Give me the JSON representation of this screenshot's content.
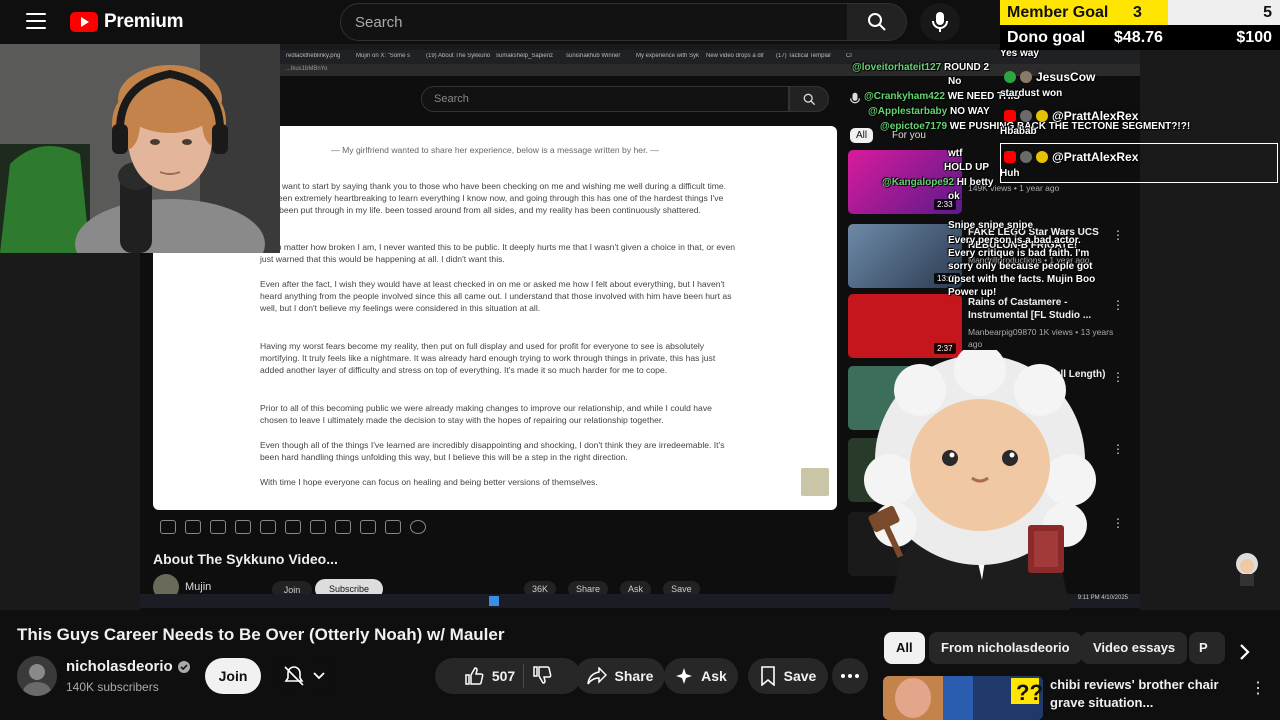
{
  "header": {
    "logo_text": "Premium",
    "search_placeholder": "Search"
  },
  "goals": {
    "member_label": "Member Goal",
    "member_current": "3",
    "member_target": "5",
    "dono_label": "Dono goal",
    "dono_current": "$48.76",
    "dono_target": "$100"
  },
  "stream": {
    "browser_tabs": [
      "redlacktheblinky.png",
      "Mujin on X: \"Some s",
      "(19) About The Sykkuno",
      "sumakshelp_Sapienz",
      "sunishakhub Winner",
      "My experience with Syk",
      "New video drops a dif",
      "(17) Tactical Templar",
      "Cl"
    ],
    "url": "...lkus1bMBnYo",
    "inner_search_placeholder": "Search",
    "doc": {
      "header": "— My girlfriend wanted to share her experience, below is a message written by her. —",
      "paragraphs": [
        "ere, I want to start by saying thank you to those who have been checking on me and wishing me well during a difficult time. It's been extremely heartbreaking to learn everything I know now, and going through this has one of the hardest things I've ever been put through in my life. been tossed around from all sides, and my reality has been continuously shattered.",
        "gh no matter how broken I am, I never wanted this to be public. It deeply hurts me that I wasn't given a choice in that, or even just warned that this would be happening at all. I didn't want this.",
        "Even after the fact, I wish they would have at least checked in on me or asked me how I felt about everything, but I haven't heard anything from the people involved since this all came out. I understand that those involved with him have been hurt as well, but I don't believe my feelings were considered in this situation at all.",
        "Having my worst fears become my reality, then put on full display and used for profit for everyone to see is absolutely mortifying. It truly feels like a nightmare. It was already hard enough trying to work through things in private, this has just added another layer of difficulty and stress on top of everything. It's made it so much harder for me to cope.",
        "Prior to all of this becoming public we were already making changes to improve our relationship, and while I could have chosen to leave I ultimately made the decision to stay with the hopes of repairing our relationship together.",
        "Even though all of the things I've learned are incredibly disappointing and shocking, I don't think they are irredeemable. It's been hard handling things unfolding this way, but I believe this will be a step in the right direction.",
        "With time I hope everyone can focus on healing and being better versions of themselves."
      ]
    },
    "about_title": "About The Sykkuno Video...",
    "mini_channel": "Mujin",
    "mini_join": "Join",
    "mini_subscribe": "Subscribe",
    "mini_actions": [
      "36K",
      "",
      "Share",
      "Ask",
      "Save"
    ],
    "rec_tabs": [
      "All",
      "For you"
    ],
    "recs": [
      {
        "title": "",
        "meta": "149K views • 1 year ago",
        "duration": "2:33",
        "color": "#b5178a"
      },
      {
        "title": "FAKE LEGO Star Wars UCS NEBULON-B FRIGATE!",
        "meta": "Mandrillproductions • 1 year ago",
        "duration": "13:40",
        "color": "#3a5f8a"
      },
      {
        "title": "Rains of Castamere - Instrumental [FL Studio ...",
        "meta": "Manbearpig09870 1K views • 13 years ago",
        "duration": "2:37",
        "color": "#c4161c"
      },
      {
        "title": "...ull Length)",
        "meta": "",
        "duration": "",
        "color": "#3c6e5a"
      }
    ],
    "taskbar_clock": "9:11 PM 4/10/2025"
  },
  "chat": {
    "lines": [
      {
        "user": "",
        "msg": "Yes way"
      },
      {
        "user": "@loveitorhateit127",
        "msg": "ROUND 2"
      },
      {
        "user": "",
        "msg": "No"
      },
      {
        "user": "@Crankyham422",
        "msg": "WE NEED THIS"
      },
      {
        "user": "@Applestarbaby",
        "msg": "NO WAY"
      },
      {
        "user": "@epictoe7179",
        "msg": "WE PUSHING BACK THE TECTONE SEGMENT?!?!"
      },
      {
        "user": "",
        "msg": "wtf"
      },
      {
        "user": "",
        "msg": "HOLD UP"
      },
      {
        "user": "@Kangalope92",
        "msg": "HI betty"
      },
      {
        "user": "",
        "msg": "ok"
      },
      {
        "user": "",
        "msg": "Snipe snipe snipe"
      },
      {
        "user": "",
        "msg": "Every person is a bad actor. Every critique is bad faith. I'm sorry only because people got upset with the facts. Mujin Boo Power up!"
      }
    ],
    "big": [
      {
        "name": "JesusCow",
        "msg": "stardust won"
      },
      {
        "name": "@PrattAlexRex",
        "msg": "Hbabab"
      },
      {
        "name": "@PrattAlexRex",
        "msg": "Huh"
      }
    ]
  },
  "video": {
    "title": "This Guys Career Needs to Be Over (Otterly Noah) w/ Mauler",
    "channel": "nicholasdeorio",
    "subscribers": "140K subscribers",
    "join": "Join",
    "likes": "507",
    "share": "Share",
    "ask": "Ask",
    "save": "Save"
  },
  "sidebar": {
    "chips": [
      "All",
      "From nicholasdeorio",
      "Video essays",
      "P"
    ],
    "first_title": "chibi reviews' brother chair grave situation..."
  }
}
